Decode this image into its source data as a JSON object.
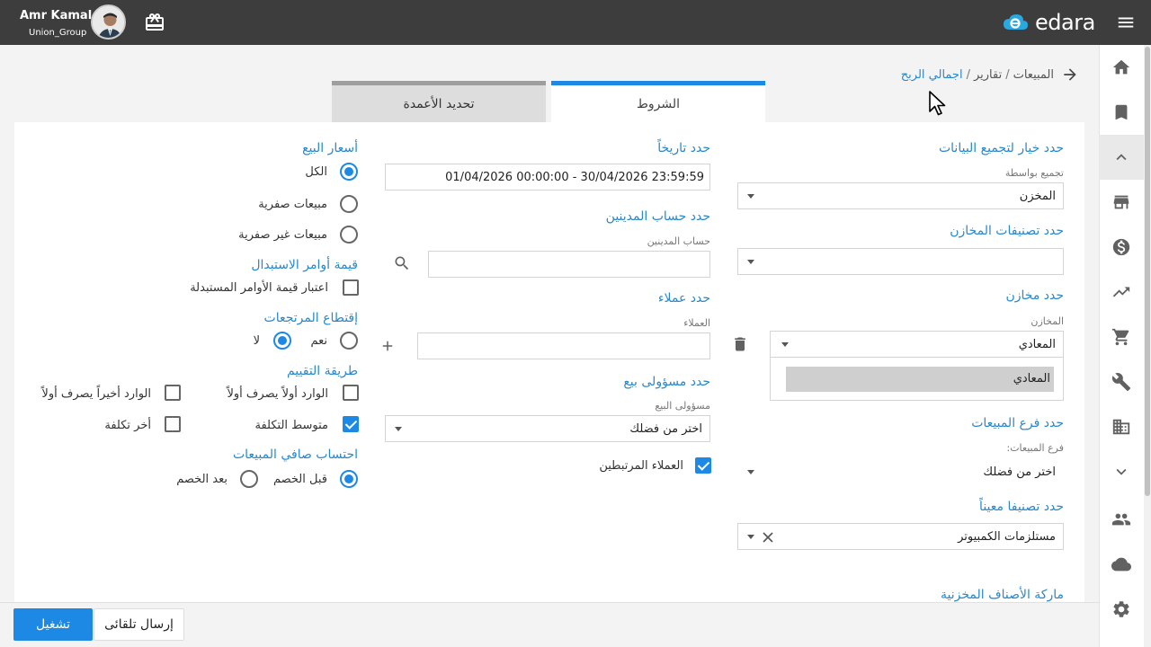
{
  "header": {
    "user_name": "Amr Kamal",
    "user_group": "Union_Group",
    "brand": "edara",
    "icons": [
      "gift-icon",
      "menu-icon",
      "edara-cloud-logo"
    ]
  },
  "breadcrumb": {
    "items": [
      "المبيعات",
      "تقارير"
    ],
    "separator": "/",
    "current": "اجمالي الربح"
  },
  "tabs": {
    "conditions": "الشروط",
    "columns": "تحديد الأعمدة"
  },
  "right_col": {
    "grouping_title": "حدد خيار لتجميع البيانات",
    "grouping_label": "تجميع بواسطة",
    "grouping_value": "المخزن",
    "store_categories_title": "حدد تصنيفات المخازن",
    "stores_title": "حدد مخازن",
    "stores_label": "المخازن",
    "stores_value": "المعادي",
    "stores_selected_item": "المعادي",
    "branch_title": "حدد فرع المبيعات",
    "branch_label": "فرع المبيعات:",
    "branch_value": "اختر من فضلك",
    "category_title": "حدد تصنيفا معيناً",
    "category_value": "مستلزمات الكمبيوتر",
    "brand_title": "ماركة الأصناف المخزنية"
  },
  "middle_col": {
    "date_title": "حدد تاريخاً",
    "date_value": "01/04/2026 00:00:00 - 30/04/2026 23:59:59",
    "debtor_title": "حدد حساب المدينين",
    "debtor_label": "حساب المدينين",
    "debtor_value": "",
    "customers_title": "حدد عملاء",
    "customers_label": "العملاء",
    "customers_value": "",
    "salesrep_title": "حدد مسؤولى بيع",
    "salesrep_label": "مسؤولى البيع",
    "salesrep_value": "اختر من فضلك",
    "linked_customers": "العملاء المرتبطين",
    "linked_customers_checked": true
  },
  "left_col": {
    "sale_prices_title": "أسعار البيع",
    "sale_prices_options": [
      "الكل",
      "مبيعات صفرية",
      "مبيعات غير صفرية"
    ],
    "sale_prices_selected": 0,
    "exchange_title": "قيمة أوامر الاستبدال",
    "exchange_option": "اعتبار قيمة الأوامر المستبدلة",
    "exchange_checked": false,
    "returns_title": "إقتطاع المرتجعات",
    "returns_yes": "نعم",
    "returns_no": "لا",
    "returns_selected": "no",
    "valuation_title": "طريقة التقييم",
    "valuation_fifo": "الوارد أولاً يصرف أولاً",
    "valuation_lifo": "الوارد أخيراً يصرف أولاً",
    "valuation_avg": "متوسط التكلفة",
    "valuation_last": "أخر تكلفة",
    "valuation_checked": [
      "متوسط التكلفة"
    ],
    "net_title": "احتساب صافي المبيعات",
    "net_before": "قبل الخصم",
    "net_after": "بعد الخصم",
    "net_selected": "before"
  },
  "footer": {
    "run_label": "تشغيل",
    "auto_send_label": "إرسال تلقائى"
  },
  "colors": {
    "accent": "#1e88e5",
    "heading": "#2a88c9",
    "topbar": "#3d3d3d"
  }
}
